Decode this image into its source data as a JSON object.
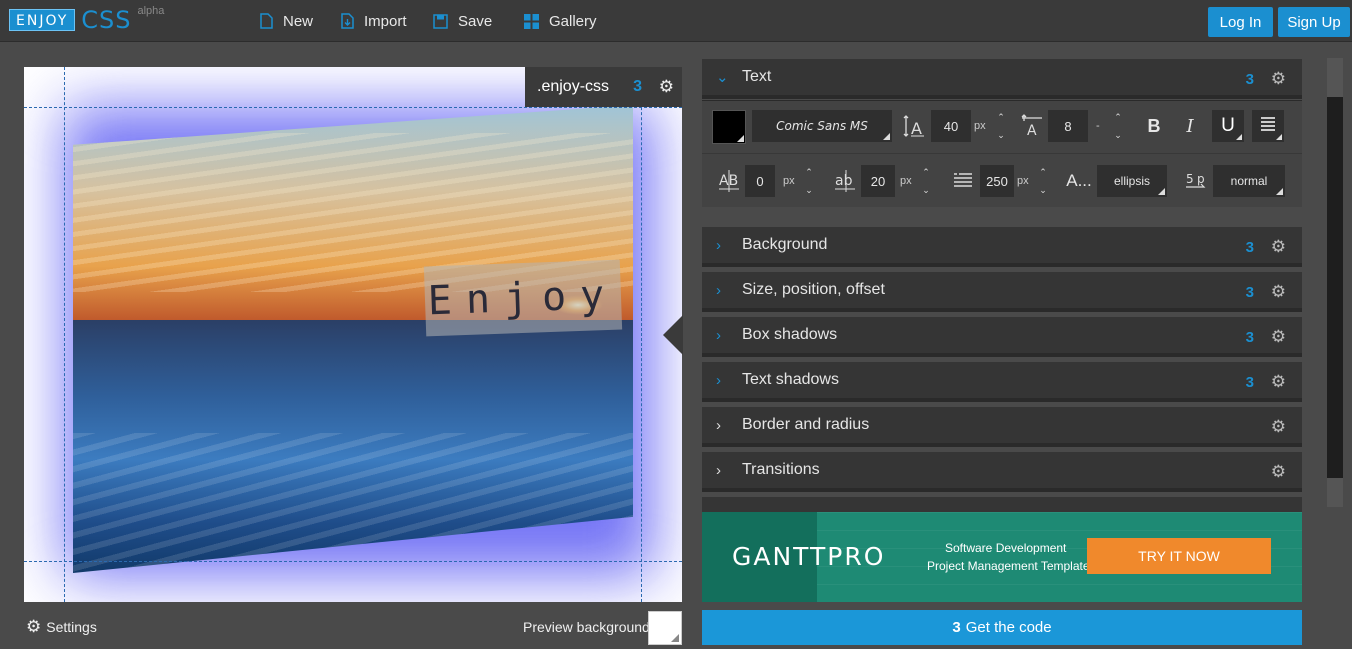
{
  "logo": {
    "enjoy": "ENJOY",
    "css": "CSS",
    "alpha": "alpha"
  },
  "nav": {
    "new": "New",
    "import": "Import",
    "save": "Save",
    "gallery": "Gallery",
    "login": "Log In",
    "signup": "Sign Up"
  },
  "preview": {
    "selector": ".enjoy-css",
    "sample_text": "Enjoy",
    "settings": "Settings",
    "preview_background": "Preview background"
  },
  "text_panel": {
    "title": "Text",
    "color": "#000000",
    "font": "Comic Sans MS",
    "font_size": "40",
    "font_size_unit": "px",
    "line_height": "8",
    "line_height_unit": "-",
    "bold": "B",
    "italic": "I",
    "underline": "U",
    "letter_spacing": "0",
    "letter_spacing_unit": "px",
    "word_spacing": "20",
    "word_spacing_unit": "px",
    "text_indent": "250",
    "text_indent_unit": "px",
    "overflow_icon": "A...",
    "text_overflow": "ellipsis",
    "white_space": "normal"
  },
  "sections": [
    {
      "label": "Background",
      "has_css3": true
    },
    {
      "label": "Size, position, offset",
      "has_css3": true
    },
    {
      "label": "Box shadows",
      "has_css3": true
    },
    {
      "label": "Text shadows",
      "has_css3": true
    },
    {
      "label": "Border and radius",
      "has_css3": false
    },
    {
      "label": "Transitions",
      "has_css3": false
    }
  ],
  "ad": {
    "logo": "GANTTPRO",
    "line1": "Software Development",
    "line2": "Project Management Template",
    "cta": "TRY IT NOW"
  },
  "get_code": "Get the code",
  "colors": {
    "accent": "#1b8fd0",
    "panel": "#353535",
    "ad_bg": "#1e8a74",
    "ad_cta": "#f0892c"
  }
}
